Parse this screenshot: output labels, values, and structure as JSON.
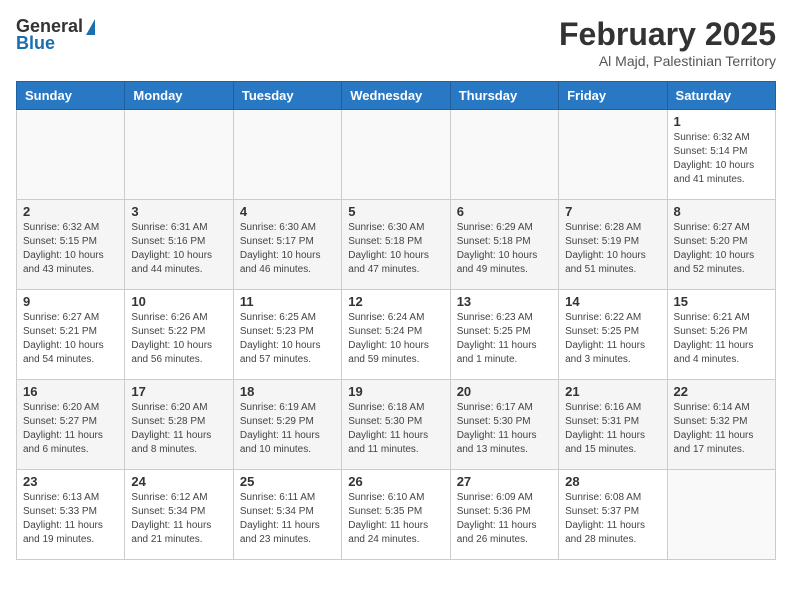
{
  "logo": {
    "general": "General",
    "blue": "Blue"
  },
  "title": "February 2025",
  "subtitle": "Al Majd, Palestinian Territory",
  "days_of_week": [
    "Sunday",
    "Monday",
    "Tuesday",
    "Wednesday",
    "Thursday",
    "Friday",
    "Saturday"
  ],
  "weeks": [
    [
      {
        "day": "",
        "info": ""
      },
      {
        "day": "",
        "info": ""
      },
      {
        "day": "",
        "info": ""
      },
      {
        "day": "",
        "info": ""
      },
      {
        "day": "",
        "info": ""
      },
      {
        "day": "",
        "info": ""
      },
      {
        "day": "1",
        "info": "Sunrise: 6:32 AM\nSunset: 5:14 PM\nDaylight: 10 hours\nand 41 minutes."
      }
    ],
    [
      {
        "day": "2",
        "info": "Sunrise: 6:32 AM\nSunset: 5:15 PM\nDaylight: 10 hours\nand 43 minutes."
      },
      {
        "day": "3",
        "info": "Sunrise: 6:31 AM\nSunset: 5:16 PM\nDaylight: 10 hours\nand 44 minutes."
      },
      {
        "day": "4",
        "info": "Sunrise: 6:30 AM\nSunset: 5:17 PM\nDaylight: 10 hours\nand 46 minutes."
      },
      {
        "day": "5",
        "info": "Sunrise: 6:30 AM\nSunset: 5:18 PM\nDaylight: 10 hours\nand 47 minutes."
      },
      {
        "day": "6",
        "info": "Sunrise: 6:29 AM\nSunset: 5:18 PM\nDaylight: 10 hours\nand 49 minutes."
      },
      {
        "day": "7",
        "info": "Sunrise: 6:28 AM\nSunset: 5:19 PM\nDaylight: 10 hours\nand 51 minutes."
      },
      {
        "day": "8",
        "info": "Sunrise: 6:27 AM\nSunset: 5:20 PM\nDaylight: 10 hours\nand 52 minutes."
      }
    ],
    [
      {
        "day": "9",
        "info": "Sunrise: 6:27 AM\nSunset: 5:21 PM\nDaylight: 10 hours\nand 54 minutes."
      },
      {
        "day": "10",
        "info": "Sunrise: 6:26 AM\nSunset: 5:22 PM\nDaylight: 10 hours\nand 56 minutes."
      },
      {
        "day": "11",
        "info": "Sunrise: 6:25 AM\nSunset: 5:23 PM\nDaylight: 10 hours\nand 57 minutes."
      },
      {
        "day": "12",
        "info": "Sunrise: 6:24 AM\nSunset: 5:24 PM\nDaylight: 10 hours\nand 59 minutes."
      },
      {
        "day": "13",
        "info": "Sunrise: 6:23 AM\nSunset: 5:25 PM\nDaylight: 11 hours\nand 1 minute."
      },
      {
        "day": "14",
        "info": "Sunrise: 6:22 AM\nSunset: 5:25 PM\nDaylight: 11 hours\nand 3 minutes."
      },
      {
        "day": "15",
        "info": "Sunrise: 6:21 AM\nSunset: 5:26 PM\nDaylight: 11 hours\nand 4 minutes."
      }
    ],
    [
      {
        "day": "16",
        "info": "Sunrise: 6:20 AM\nSunset: 5:27 PM\nDaylight: 11 hours\nand 6 minutes."
      },
      {
        "day": "17",
        "info": "Sunrise: 6:20 AM\nSunset: 5:28 PM\nDaylight: 11 hours\nand 8 minutes."
      },
      {
        "day": "18",
        "info": "Sunrise: 6:19 AM\nSunset: 5:29 PM\nDaylight: 11 hours\nand 10 minutes."
      },
      {
        "day": "19",
        "info": "Sunrise: 6:18 AM\nSunset: 5:30 PM\nDaylight: 11 hours\nand 11 minutes."
      },
      {
        "day": "20",
        "info": "Sunrise: 6:17 AM\nSunset: 5:30 PM\nDaylight: 11 hours\nand 13 minutes."
      },
      {
        "day": "21",
        "info": "Sunrise: 6:16 AM\nSunset: 5:31 PM\nDaylight: 11 hours\nand 15 minutes."
      },
      {
        "day": "22",
        "info": "Sunrise: 6:14 AM\nSunset: 5:32 PM\nDaylight: 11 hours\nand 17 minutes."
      }
    ],
    [
      {
        "day": "23",
        "info": "Sunrise: 6:13 AM\nSunset: 5:33 PM\nDaylight: 11 hours\nand 19 minutes."
      },
      {
        "day": "24",
        "info": "Sunrise: 6:12 AM\nSunset: 5:34 PM\nDaylight: 11 hours\nand 21 minutes."
      },
      {
        "day": "25",
        "info": "Sunrise: 6:11 AM\nSunset: 5:34 PM\nDaylight: 11 hours\nand 23 minutes."
      },
      {
        "day": "26",
        "info": "Sunrise: 6:10 AM\nSunset: 5:35 PM\nDaylight: 11 hours\nand 24 minutes."
      },
      {
        "day": "27",
        "info": "Sunrise: 6:09 AM\nSunset: 5:36 PM\nDaylight: 11 hours\nand 26 minutes."
      },
      {
        "day": "28",
        "info": "Sunrise: 6:08 AM\nSunset: 5:37 PM\nDaylight: 11 hours\nand 28 minutes."
      },
      {
        "day": "",
        "info": ""
      }
    ]
  ]
}
